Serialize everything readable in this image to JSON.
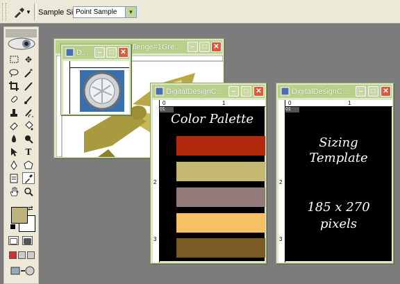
{
  "options_bar": {
    "tool_icon": "eyedropper-icon",
    "sample_size_label": "Sample Size:",
    "sample_size_value": "Point Sample"
  },
  "toolbox": {
    "tools": [
      "marquee",
      "move",
      "lasso",
      "magic-wand",
      "crop",
      "slice",
      "healing-brush",
      "brush",
      "clone-stamp",
      "history-brush",
      "eraser",
      "paint-bucket",
      "blur",
      "dodge",
      "path-selection",
      "type",
      "pen",
      "shape",
      "notes",
      "eyedropper",
      "hand",
      "zoom"
    ],
    "foreground_color": "#bcb47a",
    "background_color": "#ffffff"
  },
  "windows": {
    "back1": {
      "title": "...allenge#1Gre..."
    },
    "back2": {
      "title": "D..."
    },
    "palette": {
      "title": "DigitalDesignC...",
      "layer_badge": "01",
      "heading": "Color Palette",
      "swatches": [
        "#b2290e",
        "#c5b872",
        "#947b7b",
        "#f7c163",
        "#7b5b23"
      ]
    },
    "sizing": {
      "title": "DigitalDesignC...",
      "layer_badge": "01",
      "line1": "Sizing",
      "line2": "Template",
      "line3": "185 x 270",
      "line4": "pixels"
    }
  }
}
